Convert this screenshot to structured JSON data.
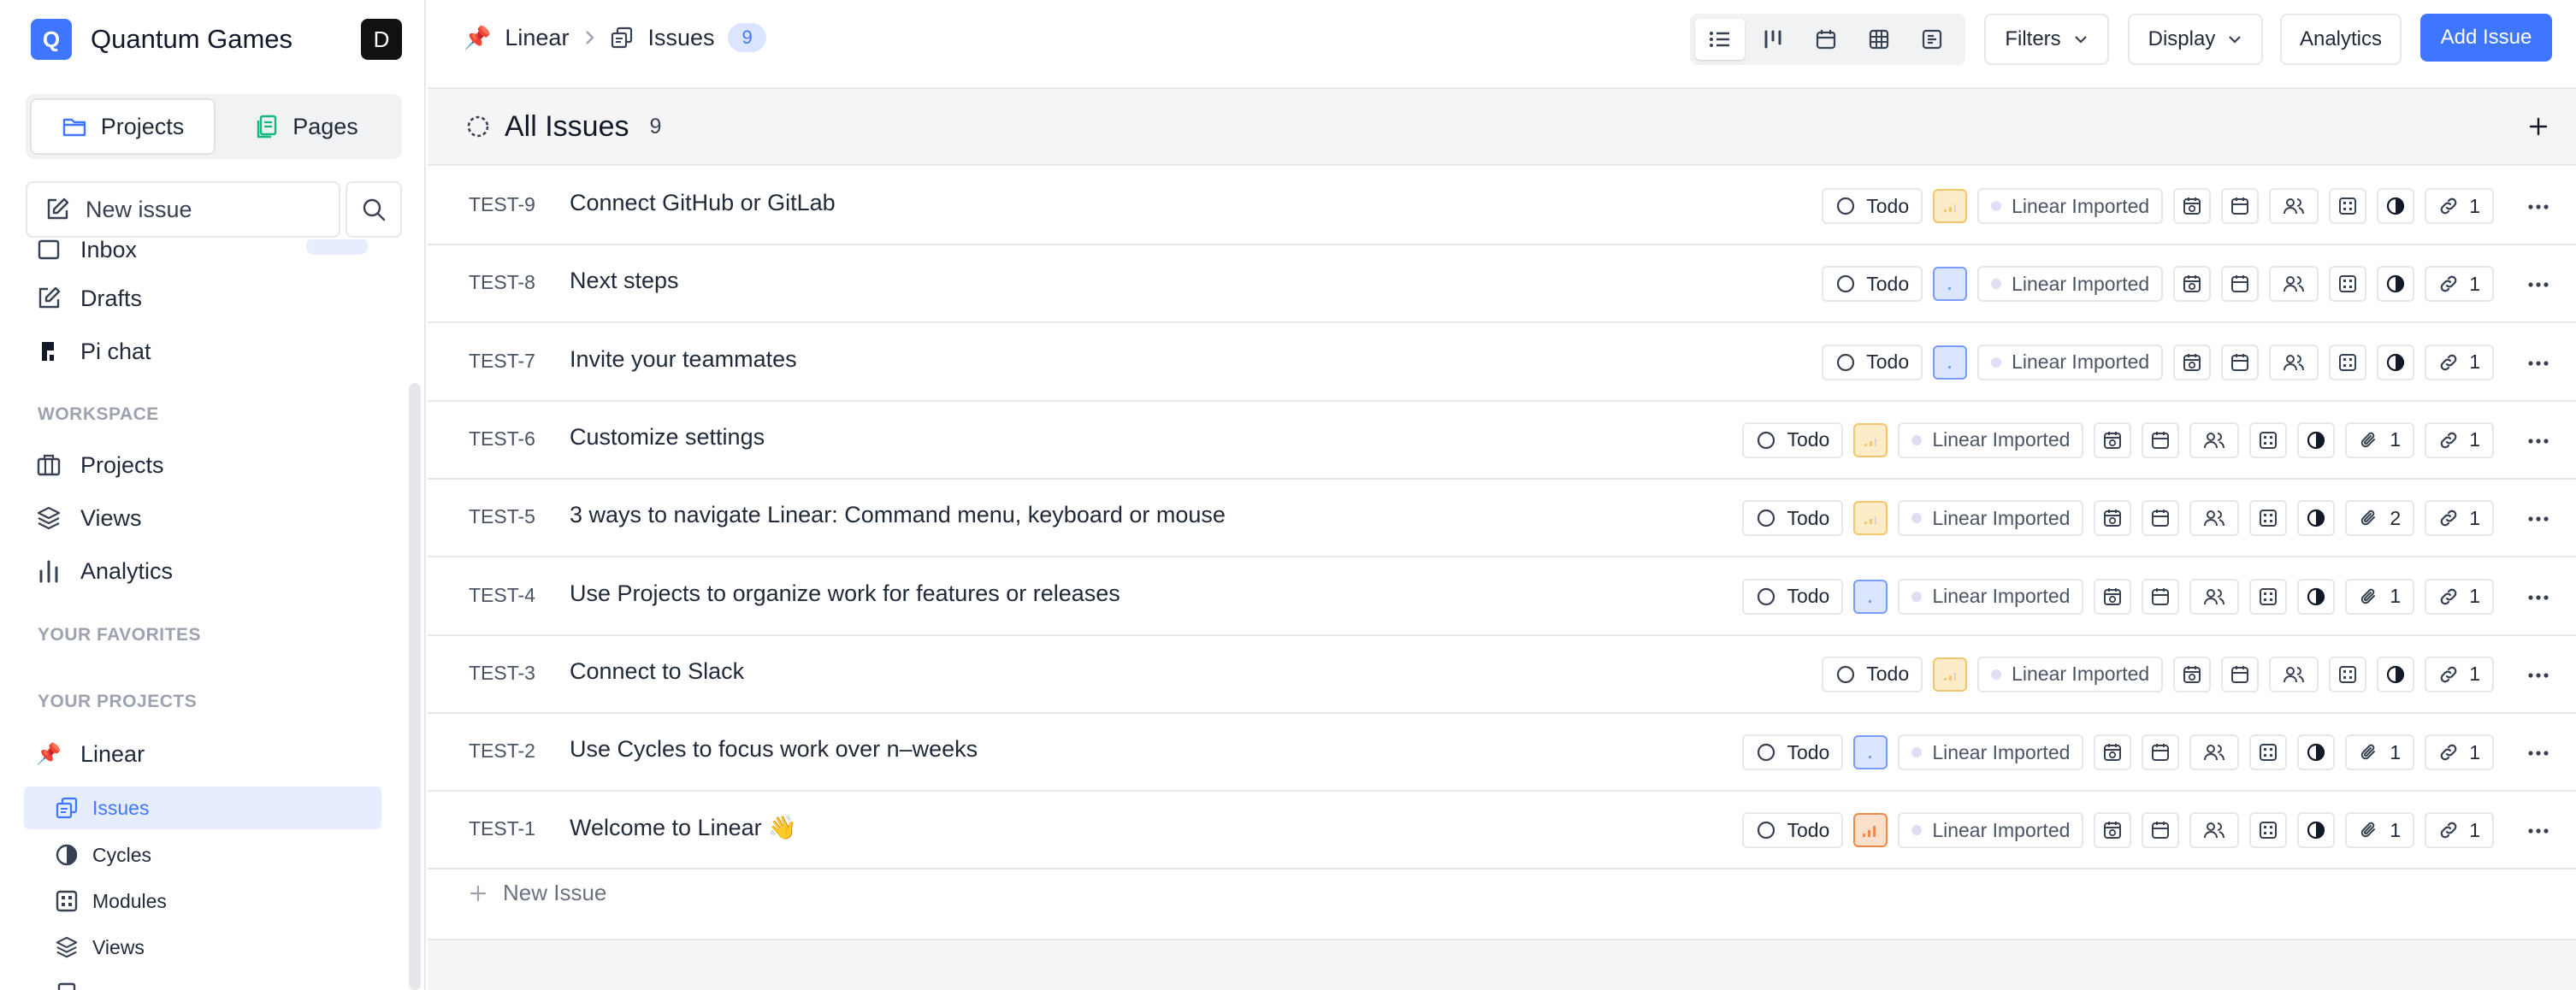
{
  "workspace": {
    "initial": "Q",
    "name": "Quantum Games",
    "user_initial": "D"
  },
  "switcher": {
    "projects_label": "Projects",
    "pages_label": "Pages"
  },
  "sidebar": {
    "new_issue_label": "New issue",
    "partial_item_label": "Inbox",
    "nav": [
      {
        "label": "Drafts",
        "icon": "pencil-square-icon"
      },
      {
        "label": "Pi chat",
        "icon": "pi-icon"
      }
    ],
    "workspace_header": "WORKSPACE",
    "workspace_items": [
      {
        "label": "Projects",
        "icon": "briefcase-icon"
      },
      {
        "label": "Views",
        "icon": "layers-icon"
      },
      {
        "label": "Analytics",
        "icon": "bar-chart-icon"
      }
    ],
    "favorites_header": "YOUR FAVORITES",
    "projects_header": "YOUR PROJECTS",
    "project": {
      "emoji": "📌",
      "name": "Linear"
    },
    "project_items": [
      {
        "label": "Issues",
        "icon": "issues-icon",
        "active": true
      },
      {
        "label": "Cycles",
        "icon": "cycle-icon",
        "active": false
      },
      {
        "label": "Modules",
        "icon": "module-icon",
        "active": false
      },
      {
        "label": "Views",
        "icon": "layers-icon",
        "active": false
      }
    ]
  },
  "topbar": {
    "project_emoji": "📌",
    "project_name": "Linear",
    "section": "Issues",
    "count": "9",
    "filters_label": "Filters",
    "display_label": "Display",
    "analytics_label": "Analytics",
    "add_issue_label": "Add Issue",
    "layouts": [
      "list-layout-icon",
      "kanban-layout-icon",
      "calendar-layout-icon",
      "spreadsheet-layout-icon",
      "gantt-layout-icon"
    ],
    "active_layout": "list-layout-icon"
  },
  "group": {
    "title": "All Issues",
    "count": "9"
  },
  "state_label": "Todo",
  "label_name": "Linear Imported",
  "priority_colors": {
    "low": "#f6c56b",
    "none": "#7a9cff",
    "urgent": "#f08a4b"
  },
  "issues": [
    {
      "id": "TEST-9",
      "title": "Connect GitHub or GitLab",
      "priority": "low",
      "attachments": "",
      "links": "1"
    },
    {
      "id": "TEST-8",
      "title": "Next steps",
      "priority": "none",
      "attachments": "",
      "links": "1"
    },
    {
      "id": "TEST-7",
      "title": "Invite your teammates",
      "priority": "none",
      "attachments": "",
      "links": "1"
    },
    {
      "id": "TEST-6",
      "title": "Customize settings",
      "priority": "low",
      "attachments": "1",
      "links": "1"
    },
    {
      "id": "TEST-5",
      "title": "3 ways to navigate Linear: Command menu, keyboard or mouse",
      "priority": "low",
      "attachments": "2",
      "links": "1"
    },
    {
      "id": "TEST-4",
      "title": "Use Projects to organize work for features or releases",
      "priority": "none",
      "attachments": "1",
      "links": "1"
    },
    {
      "id": "TEST-3",
      "title": "Connect to Slack",
      "priority": "low",
      "attachments": "",
      "links": "1"
    },
    {
      "id": "TEST-2",
      "title": "Use Cycles to focus work over n–weeks",
      "priority": "none",
      "attachments": "1",
      "links": "1"
    },
    {
      "id": "TEST-1",
      "title": "Welcome to Linear 👋",
      "priority": "urgent",
      "attachments": "1",
      "links": "1"
    }
  ],
  "footer": {
    "new_issue_label": "New Issue"
  }
}
